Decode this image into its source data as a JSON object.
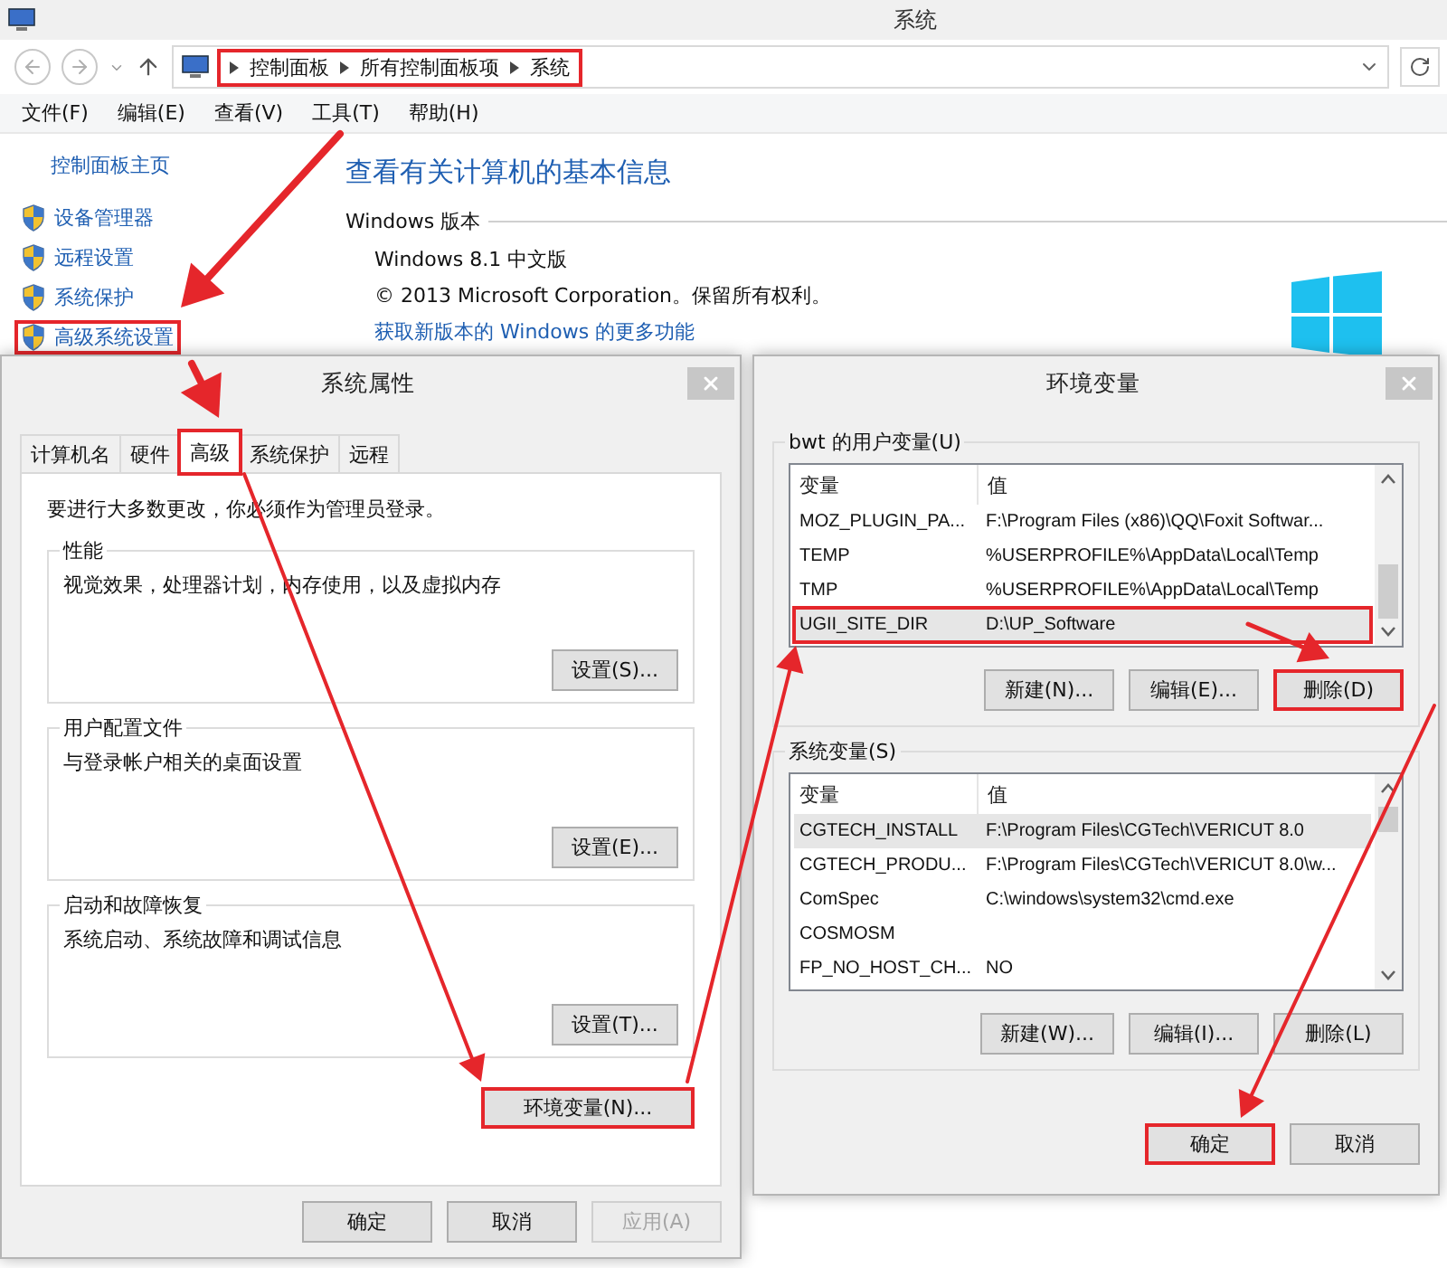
{
  "explorer": {
    "title": "系统",
    "breadcrumb": {
      "highlighted": true,
      "items": [
        "控制面板",
        "所有控制面板项",
        "系统"
      ]
    },
    "menu": [
      "文件(F)",
      "编辑(E)",
      "查看(V)",
      "工具(T)",
      "帮助(H)"
    ],
    "sidebar": {
      "home": "控制面板主页",
      "items": [
        {
          "label": "设备管理器",
          "highlighted": false
        },
        {
          "label": "远程设置",
          "highlighted": false
        },
        {
          "label": "系统保护",
          "highlighted": false
        },
        {
          "label": "高级系统设置",
          "highlighted": true
        }
      ]
    },
    "heading": "查看有关计算机的基本信息",
    "section": "Windows 版本",
    "edition": "Windows 8.1 中文版",
    "copyright": "© 2013 Microsoft Corporation。保留所有权利。",
    "link": "获取新版本的 Windows 的更多功能"
  },
  "system_properties": {
    "title": "系统属性",
    "tabs": [
      {
        "label": "计算机名",
        "selected": false,
        "highlighted": false
      },
      {
        "label": "硬件",
        "selected": false,
        "highlighted": false
      },
      {
        "label": "高级",
        "selected": true,
        "highlighted": true
      },
      {
        "label": "系统保护",
        "selected": false,
        "highlighted": false
      },
      {
        "label": "远程",
        "selected": false,
        "highlighted": false
      }
    ],
    "notice": "要进行大多数更改，你必须作为管理员登录。",
    "groups": [
      {
        "legend": "性能",
        "description": "视觉效果，处理器计划，内存使用，以及虚拟内存",
        "button": "设置(S)..."
      },
      {
        "legend": "用户配置文件",
        "description": "与登录帐户相关的桌面设置",
        "button": "设置(E)..."
      },
      {
        "legend": "启动和故障恢复",
        "description": "系统启动、系统故障和调试信息",
        "button": "设置(T)..."
      }
    ],
    "env_button": {
      "label": "环境变量(N)...",
      "highlighted": true
    },
    "buttons": [
      {
        "label": "确定",
        "disabled": false
      },
      {
        "label": "取消",
        "disabled": false
      },
      {
        "label": "应用(A)",
        "disabled": true
      }
    ]
  },
  "environment_variables": {
    "title": "环境变量",
    "sections": [
      {
        "legend": "bwt 的用户变量(U)",
        "columns": [
          "变量",
          "值"
        ],
        "rows": [
          {
            "name": "MOZ_PLUGIN_PA...",
            "value": "F:\\Program Files (x86)\\QQ\\Foxit Softwar...",
            "selected": false,
            "highlighted": false
          },
          {
            "name": "TEMP",
            "value": "%USERPROFILE%\\AppData\\Local\\Temp",
            "selected": false,
            "highlighted": false
          },
          {
            "name": "TMP",
            "value": "%USERPROFILE%\\AppData\\Local\\Temp",
            "selected": false,
            "highlighted": false
          },
          {
            "name": "UGII_SITE_DIR",
            "value": "D:\\UP_Software",
            "selected": true,
            "highlighted": true
          }
        ],
        "buttons": [
          {
            "label": "新建(N)...",
            "highlighted": false
          },
          {
            "label": "编辑(E)...",
            "highlighted": false
          },
          {
            "label": "删除(D)",
            "highlighted": true
          }
        ]
      },
      {
        "legend": "系统变量(S)",
        "columns": [
          "变量",
          "值"
        ],
        "rows": [
          {
            "name": "CGTECH_INSTALL",
            "value": "F:\\Program Files\\CGTech\\VERICUT 8.0",
            "selected": true,
            "highlighted": false
          },
          {
            "name": "CGTECH_PRODU...",
            "value": "F:\\Program Files\\CGTech\\VERICUT 8.0\\w...",
            "selected": false,
            "highlighted": false
          },
          {
            "name": "ComSpec",
            "value": "C:\\windows\\system32\\cmd.exe",
            "selected": false,
            "highlighted": false
          },
          {
            "name": "COSMOSM",
            "selected": false,
            "highlighted": false
          },
          {
            "name": "FP_NO_HOST_CH...",
            "value": "NO",
            "selected": false,
            "highlighted": false
          }
        ],
        "buttons": [
          {
            "label": "新建(W)...",
            "highlighted": false
          },
          {
            "label": "编辑(I)...",
            "highlighted": false
          },
          {
            "label": "删除(L)",
            "highlighted": false
          }
        ]
      }
    ],
    "buttons": [
      {
        "label": "确定",
        "highlighted": true
      },
      {
        "label": "取消",
        "highlighted": false
      }
    ]
  }
}
